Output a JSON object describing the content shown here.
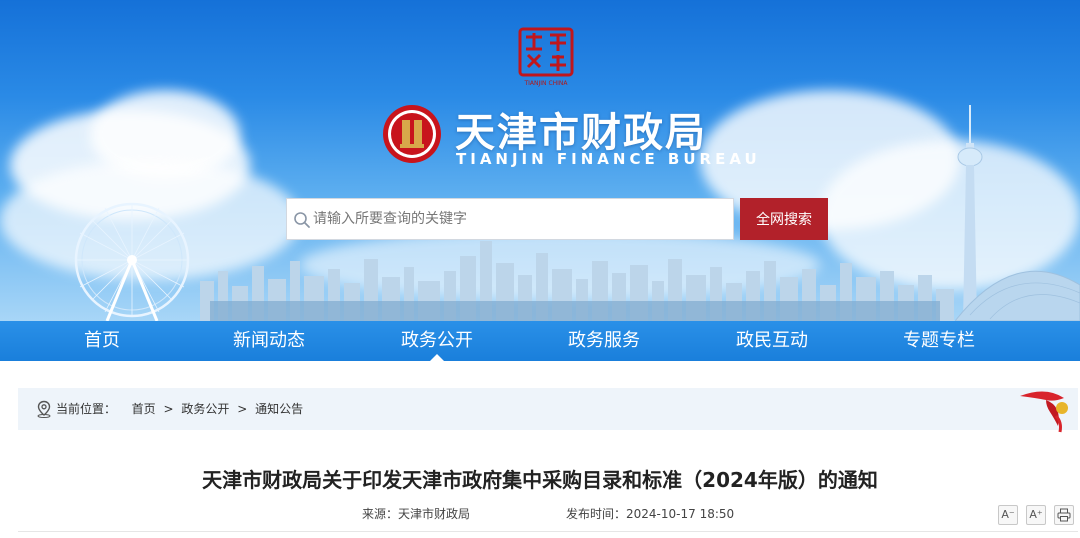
{
  "header": {
    "seal_caption": "TIANJIN CHINA",
    "site_title": "天津市财政局",
    "site_subtitle": "TIANJIN FINANCE BUREAU"
  },
  "search": {
    "placeholder": "请输入所要查询的关键字",
    "button_label": "全网搜索"
  },
  "nav": {
    "items": [
      {
        "label": "首页"
      },
      {
        "label": "新闻动态"
      },
      {
        "label": "政务公开"
      },
      {
        "label": "政务服务"
      },
      {
        "label": "政民互动"
      },
      {
        "label": "专题专栏"
      }
    ],
    "active": "政务公开"
  },
  "breadcrumb": {
    "prefix": "当前位置：",
    "items": [
      "首页",
      "政务公开",
      "通知公告"
    ],
    "separator": ">"
  },
  "article": {
    "title": "天津市财政局关于印发天津市政府集中采购目录和标准（2024年版）的通知",
    "source_label": "来源：",
    "source_value": "天津市财政局",
    "date_label": "发布时间：",
    "date_value": "2024-10-17 18:50"
  },
  "tools": {
    "font_decrease": "A⁻",
    "font_increase": "A⁺"
  },
  "colors": {
    "nav_blue": "#1e85e0",
    "search_button": "#b2212a",
    "breadcrumb_bg": "#eef4fa"
  }
}
